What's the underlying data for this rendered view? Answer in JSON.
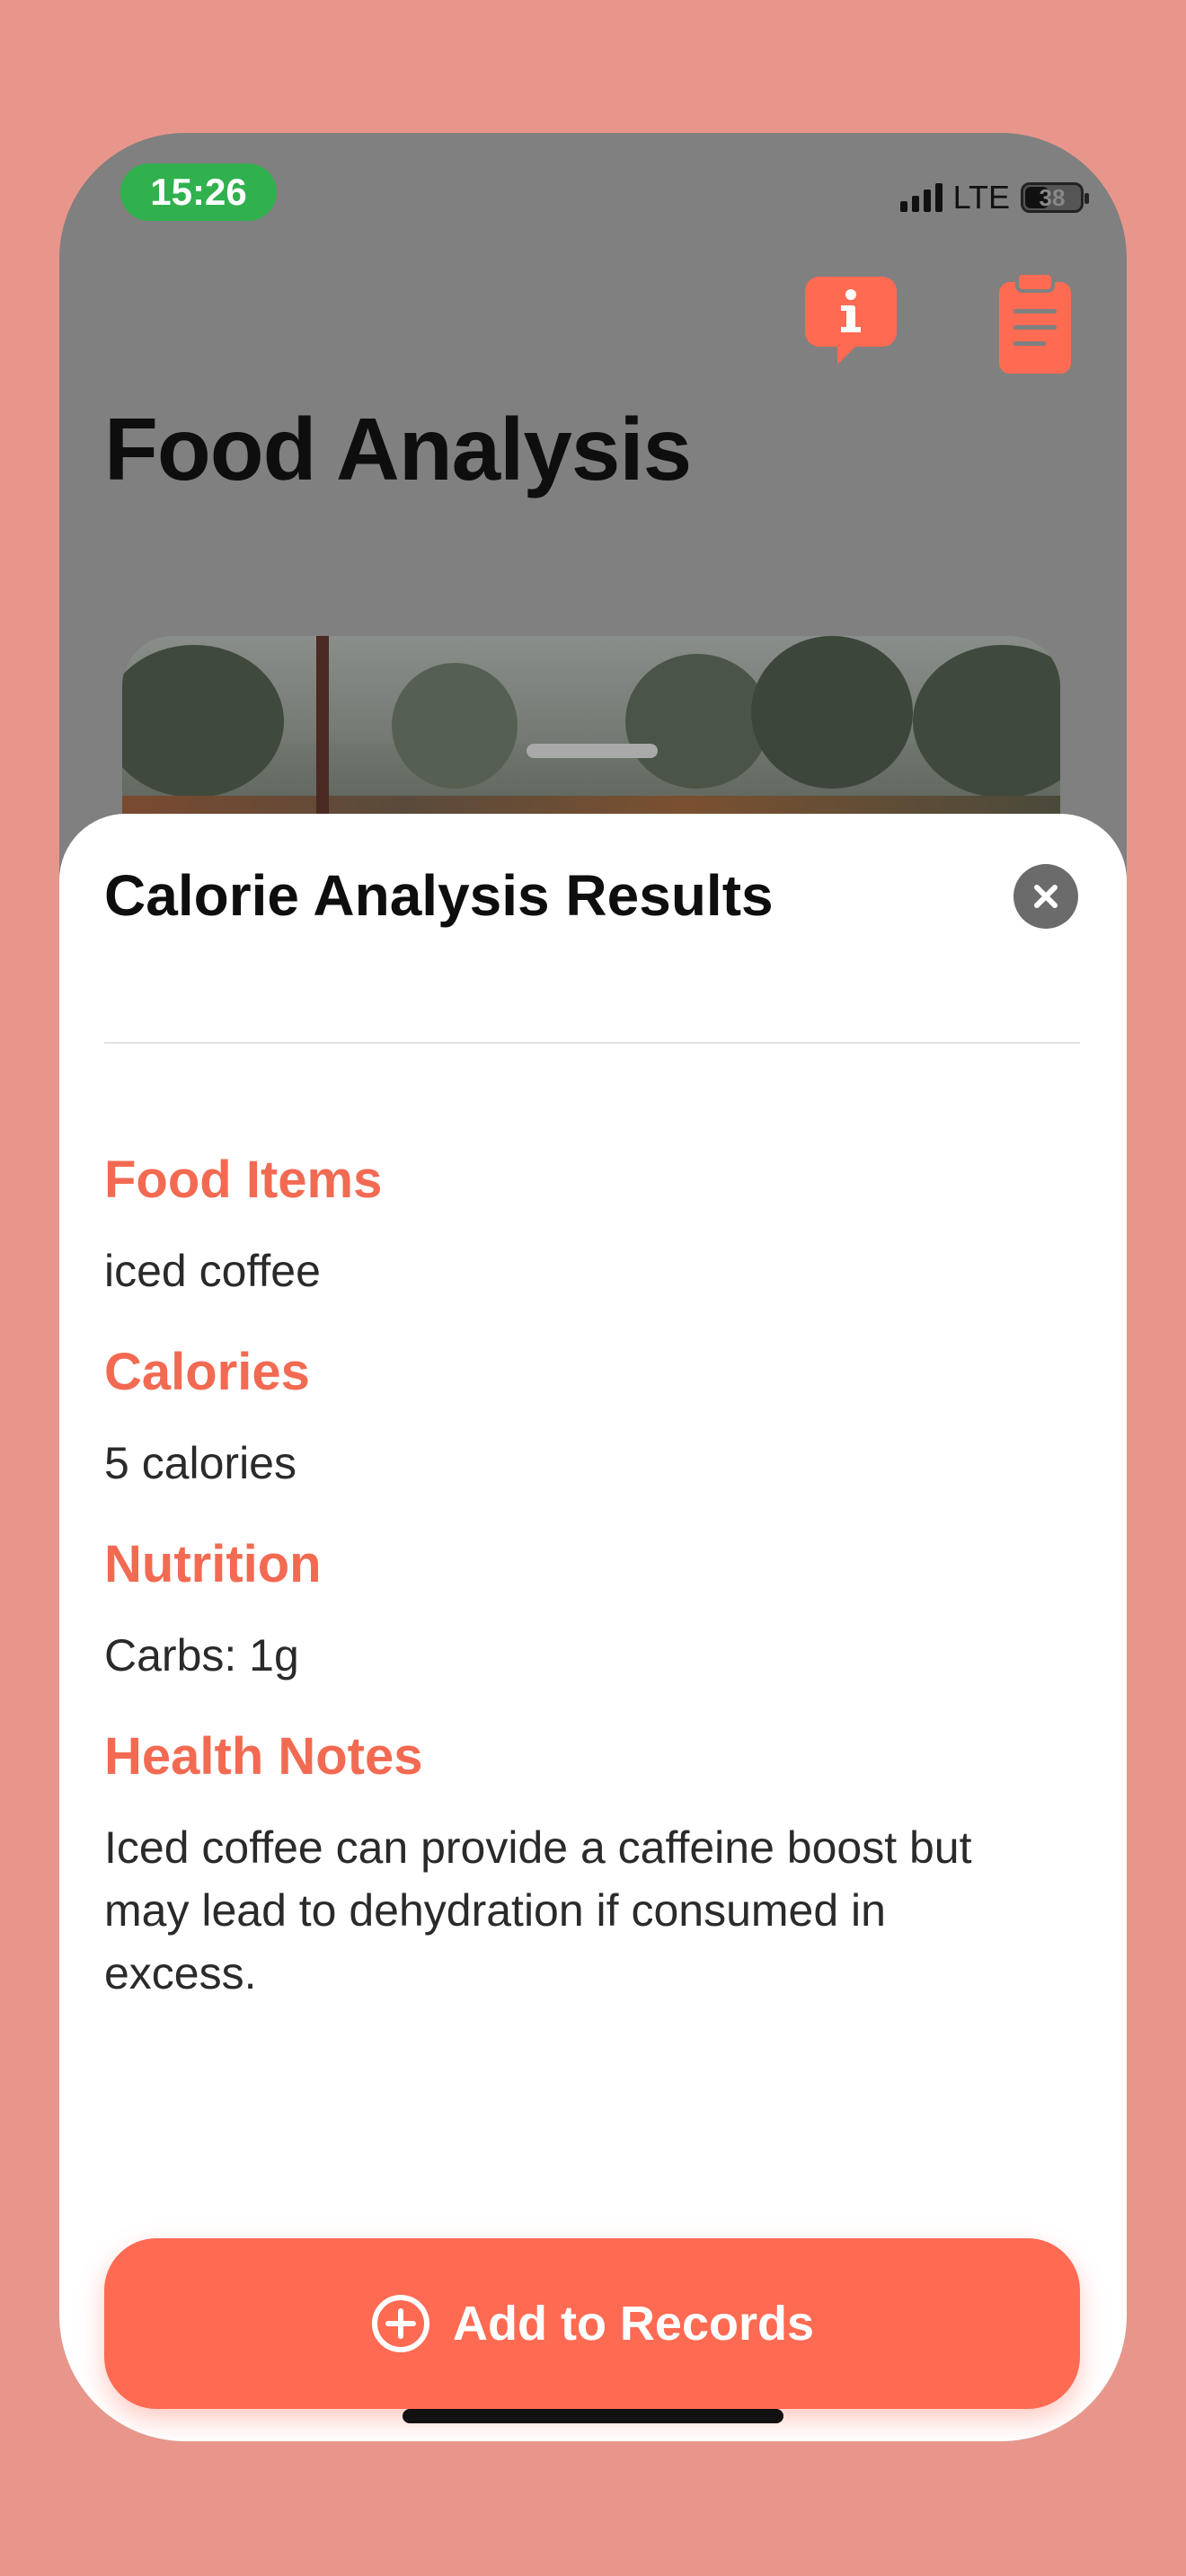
{
  "status_bar": {
    "time": "15:26",
    "network": "LTE",
    "battery": "38"
  },
  "header": {
    "title": "Food Analysis",
    "info_icon": "info-bubble-icon",
    "records_icon": "clipboard-icon"
  },
  "sheet": {
    "title": "Calorie Analysis Results",
    "close_icon": "close-icon",
    "sections": [
      {
        "heading": "Food Items",
        "body": "iced coffee"
      },
      {
        "heading": "Calories",
        "body": "5 calories"
      },
      {
        "heading": "Nutrition",
        "body": "Carbs: 1g"
      },
      {
        "heading": "Health Notes",
        "body": "Iced coffee can provide a caffeine boost but may lead to dehydration if consumed in excess."
      }
    ],
    "add_button": {
      "label": "Add to Records",
      "icon": "plus-circle-icon"
    }
  },
  "colors": {
    "accent": "#FF6A52",
    "heading": "#F26A52",
    "backdrop": "#E8968B",
    "time_pill": "#30B14E"
  }
}
